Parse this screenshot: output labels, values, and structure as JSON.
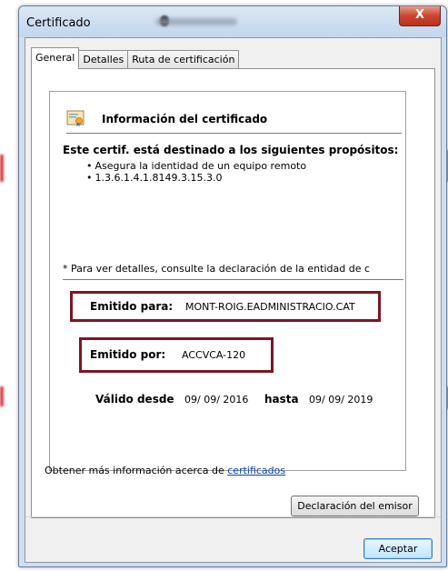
{
  "window": {
    "title": "Certificado",
    "close_label": "X"
  },
  "tabs": [
    {
      "label": "General"
    },
    {
      "label": "Detalles"
    },
    {
      "label": "Ruta de certificación"
    }
  ],
  "certificate": {
    "heading": "Información del certificado",
    "purpose_title": "Este certif. está destinado a los siguientes propósitos:",
    "purposes": [
      "Asegura la identidad de un equipo remoto",
      "1.3.6.1.4.1.8149.3.15.3.0"
    ],
    "note": "* Para ver detalles, consulte la declaración de la entidad de c",
    "issued_to_label": "Emitido para:",
    "issued_to_value": "MONT-ROIG.EADMINISTRACIO.CAT",
    "issued_by_label": "Emitido por:",
    "issued_by_value": "ACCVCA-120",
    "valid_from_label": "Válido desde",
    "valid_from_value": "09/ 09/ 2016",
    "valid_to_label": "hasta",
    "valid_to_value": "09/ 09/ 2019"
  },
  "buttons": {
    "issuer_statement": "Declaración del emisor",
    "accept": "Aceptar"
  },
  "more_info": {
    "text": "Obtener más información acerca de ",
    "link": "certificados"
  },
  "colors": {
    "highlight": "#7c1622",
    "link": "#0645ad"
  }
}
